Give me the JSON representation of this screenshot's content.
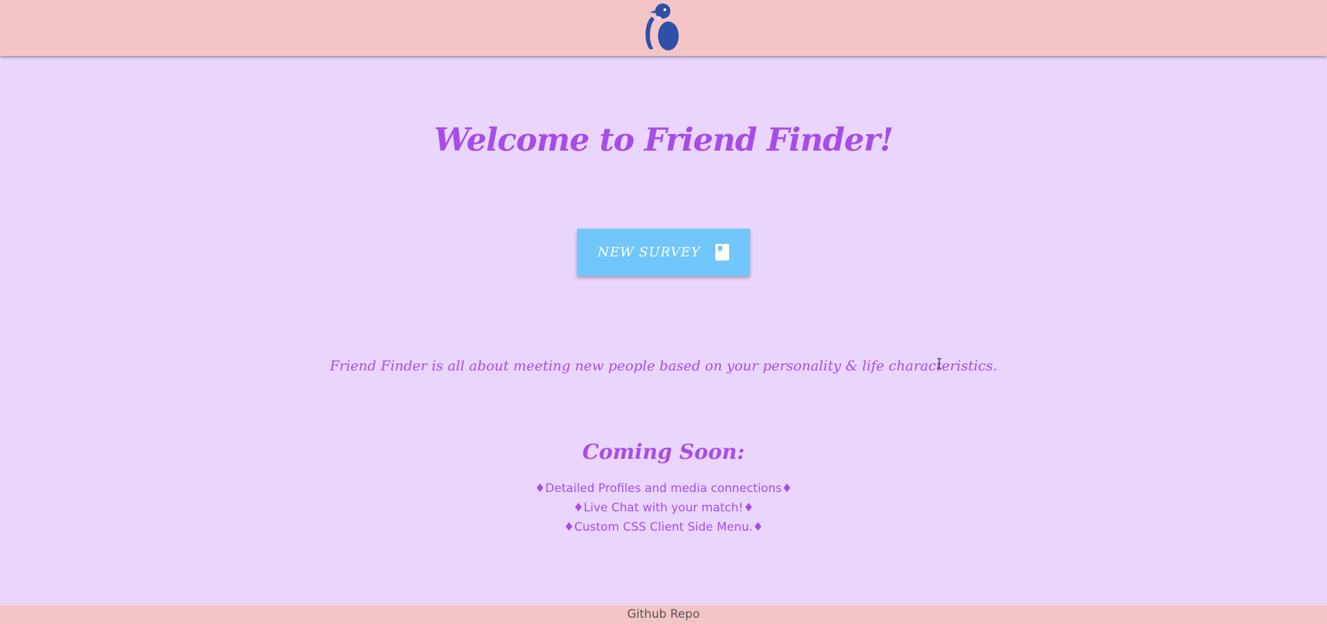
{
  "header": {
    "logo_icon": "penguin-logo-icon"
  },
  "main": {
    "title": "Welcome to Friend Finder!",
    "survey_button": {
      "label": "NEW SURVEY",
      "icon": "book-icon"
    },
    "tagline": "Friend Finder is all about meeting new people based on your personality & life characteristics.",
    "coming_soon": {
      "title": "Coming Soon:",
      "items": [
        "♦Detailed Profiles and media connections♦",
        "♦Live Chat with your match!♦",
        "♦Custom CSS Client Side Menu.♦"
      ]
    }
  },
  "footer": {
    "link_label": "Github Repo"
  },
  "colors": {
    "background": "#ead5fd",
    "header_footer": "#f4c5c6",
    "accent_text": "#a64de8",
    "button": "#71c7f9",
    "logo": "#2f4fa8"
  }
}
